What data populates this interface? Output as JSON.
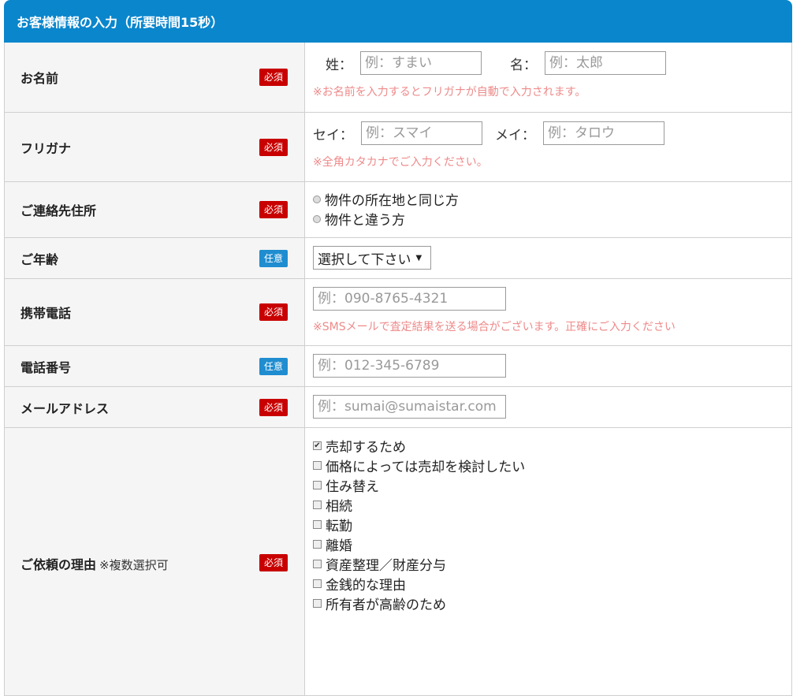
{
  "header": {
    "title": "お客様情報の入力（所要時間15秒）"
  },
  "badges": {
    "required": "必須",
    "optional": "任意"
  },
  "name": {
    "label": "お名前",
    "last_label": "姓：",
    "last_placeholder": "例：すまい",
    "first_label": "名：",
    "first_placeholder": "例：太郎",
    "hint": "※お名前を入力するとフリガナが自動で入力されます。"
  },
  "furigana": {
    "label": "フリガナ",
    "last_label": "セイ：",
    "last_placeholder": "例：スマイ",
    "first_label": "メイ：",
    "first_placeholder": "例：タロウ",
    "hint": "※全角カタカナでご入力ください。"
  },
  "address": {
    "label": "ご連絡先住所",
    "options": [
      "物件の所在地と同じ方",
      "物件と違う方"
    ]
  },
  "age": {
    "label": "ご年齢",
    "select_value": "選択して下さい"
  },
  "mobile": {
    "label": "携帯電話",
    "placeholder": "例：090-8765-4321",
    "hint": "※SMSメールで査定結果を送る場合がございます。正確にご入力ください"
  },
  "phone": {
    "label": "電話番号",
    "placeholder": "例：012-345-6789"
  },
  "email": {
    "label": "メールアドレス",
    "placeholder": "例：sumai@sumaistar.com"
  },
  "reason": {
    "label": "ご依頼の理由",
    "note": "※複数選択可",
    "options": [
      {
        "text": "売却するため",
        "checked": true
      },
      {
        "text": "価格によっては売却を検討したい",
        "checked": false
      },
      {
        "text": "住み替え",
        "checked": false
      },
      {
        "text": "相続",
        "checked": false
      },
      {
        "text": "転勤",
        "checked": false
      },
      {
        "text": "離婚",
        "checked": false
      },
      {
        "text": "資産整理／財産分与",
        "checked": false
      },
      {
        "text": "金銭的な理由",
        "checked": false
      },
      {
        "text": "所有者が高齢のため",
        "checked": false
      }
    ]
  }
}
